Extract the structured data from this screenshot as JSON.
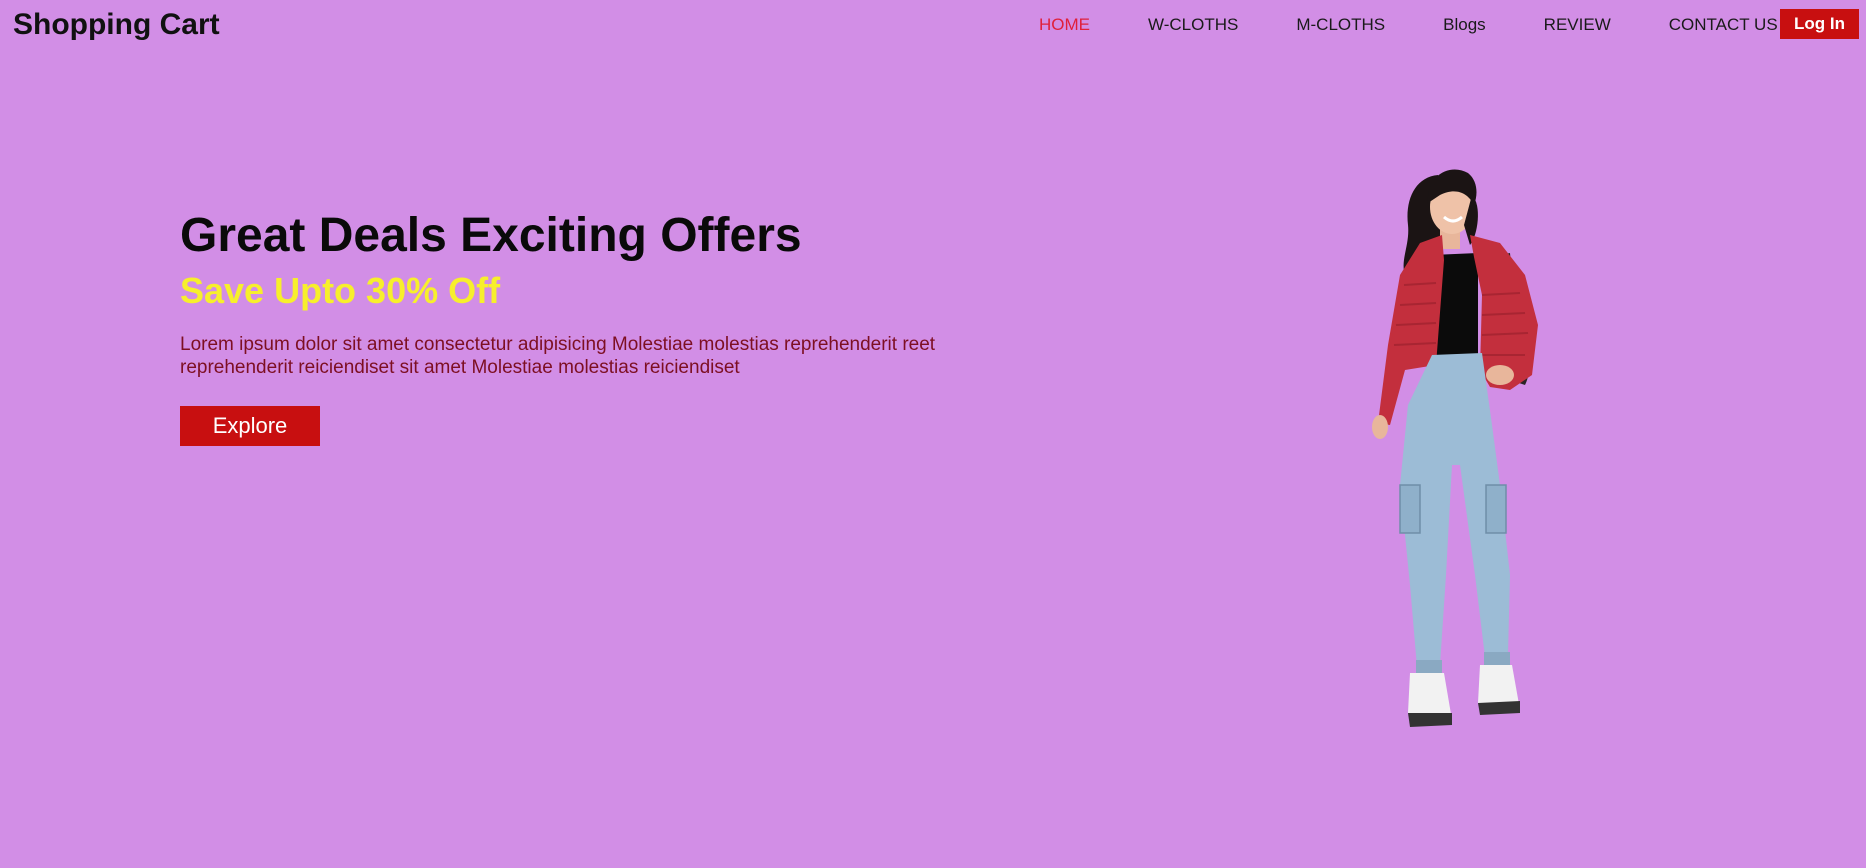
{
  "header": {
    "brand": "Shopping Cart",
    "nav": [
      "HOME",
      "W-CLOTHS",
      "M-CLOTHS",
      "Blogs",
      "REVIEW",
      "CONTACT US"
    ],
    "active_nav": "HOME",
    "login_label": "Log In"
  },
  "hero": {
    "title": "Great Deals Exciting Offers",
    "subtitle": "Save Upto 30% Off",
    "description": "Lorem ipsum dolor sit amet consectetur adipisicing Molestiae molestias reprehenderit reet reprehenderit reiciendiset sit amet Molestiae molestias reiciendiset",
    "cta_label": "Explore"
  },
  "colors": {
    "background": "#d28ee6",
    "accent": "#c80f10",
    "active_link": "#e0203a",
    "subtitle": "#f7ef2c",
    "description": "#7d0f22"
  },
  "icons": {
    "model_image": "woman-in-red-jacket-image"
  }
}
